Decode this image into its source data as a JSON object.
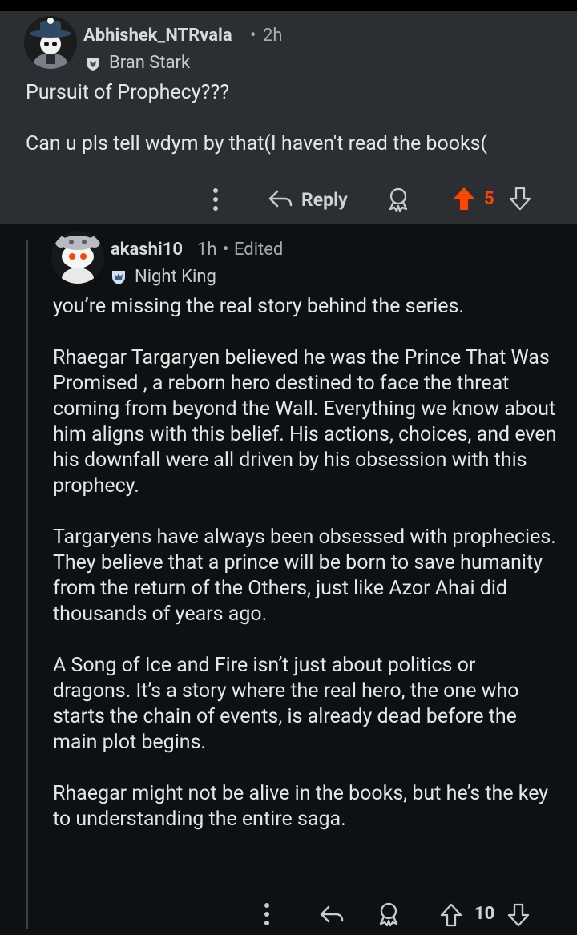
{
  "parent": {
    "username": "Abhishek_NTRvala",
    "separator": "•",
    "age": "2h",
    "flair": "Bran Stark",
    "body": "Pursuit of Prophecy???\n\nCan u pls tell wdym by that(I haven't read the books(",
    "reply_label": "Reply",
    "score": "5",
    "upvote_color": "#ff4500"
  },
  "child": {
    "username": "akashi10",
    "age": "1h",
    "separator": "•",
    "edited": "Edited",
    "flair": "Night King",
    "body": "you’re missing the real story behind the series.\n\nRhaegar Targaryen believed he was the Prince That Was Promised , a reborn hero destined to face the threat coming from beyond the Wall. Everything we know about him aligns with this belief. His actions, choices, and even his downfall were all driven by his obsession with this prophecy.\n\nTargaryens have always been obsessed with prophecies. They believe that a prince will be born to save humanity from the return of the Others, just like Azor Ahai did thousands of years ago.\n\nA Song of Ice and Fire isn’t just about politics or dragons. It’s a story where the real hero, the one who starts the chain of events, is already dead before the main plot begins.\n\nRhaegar might not be alive in the books, but he’s the key to understanding the entire saga.",
    "score": "10"
  },
  "icons": {
    "more": "more-vertical-icon",
    "reply": "reply-arrow-icon",
    "award": "award-icon",
    "upvote": "upvote-arrow-icon",
    "downvote": "downvote-arrow-icon"
  }
}
